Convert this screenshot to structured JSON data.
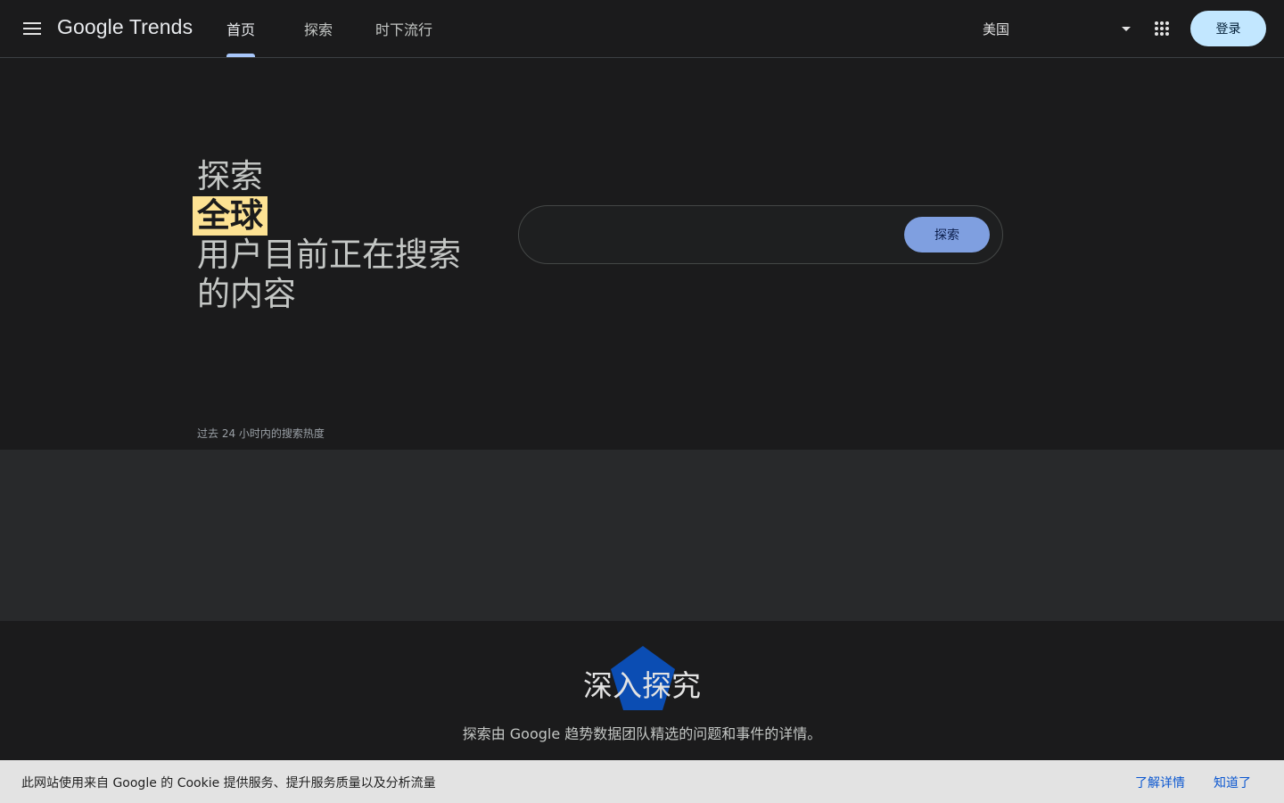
{
  "header": {
    "logo_text": "Google Trends",
    "tabs": [
      {
        "label": "首页",
        "active": true
      },
      {
        "label": "探索",
        "active": false
      },
      {
        "label": "时下流行",
        "active": false
      }
    ],
    "region": "美国",
    "signin_label": "登录",
    "icons": {
      "menu": "hamburger-menu-icon",
      "region_dropdown": "caret-down-icon",
      "apps": "apps-grid-icon"
    }
  },
  "hero": {
    "line1": "探索",
    "highlight": "全球",
    "line3": "用户目前正在搜索的内容",
    "highlight_color": "#fde293",
    "search": {
      "placeholder": "",
      "value": "",
      "button_label": "探索",
      "button_color": "#7f9fe0"
    }
  },
  "trend_caption": "过去 24 小时内的搜索热度",
  "deep_dive": {
    "title": "深入探究",
    "subtitle": "探索由 Google 趋势数据团队精选的问题和事件的详情。",
    "accent_color": "#0b4db3"
  },
  "cookie": {
    "text": "此网站使用来自 Google 的 Cookie 提供服务、提升服务质量以及分析流量",
    "learn_more": "了解详情",
    "ok": "知道了"
  }
}
